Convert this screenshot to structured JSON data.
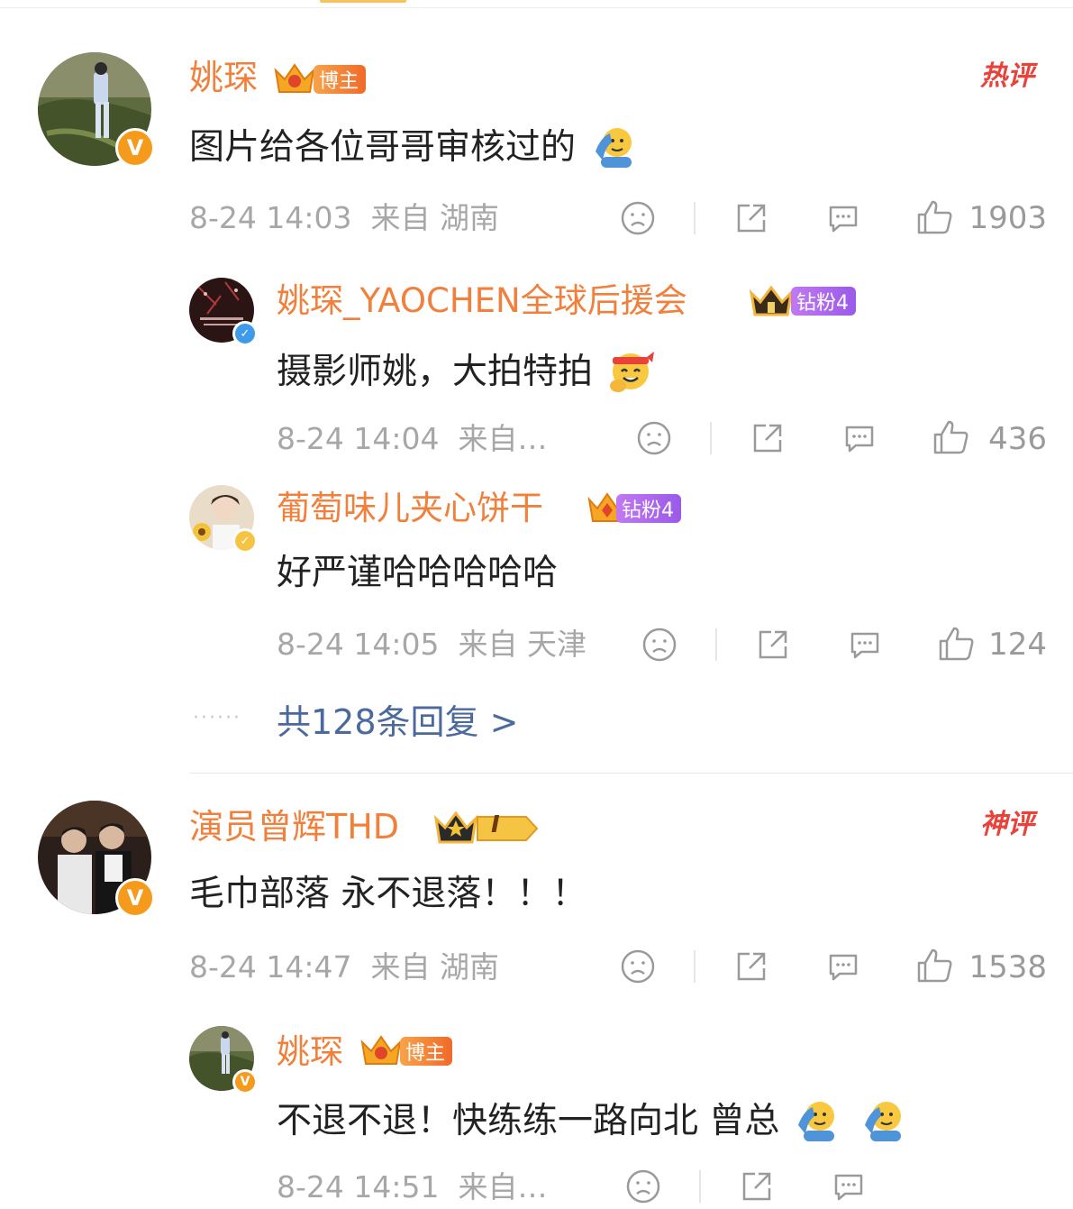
{
  "comments": [
    {
      "username": "姚琛",
      "badge": "博主",
      "text": "图片给各位哥哥审核过的",
      "emoji": "salute-emoji",
      "time": "8-24 14:03",
      "location": "来自 湖南",
      "likes": "1903",
      "tag": "热评",
      "replies": [
        {
          "username": "姚琛_YAOCHEN全球后援会",
          "badge": "钻粉4",
          "text": "摄影师姚，大拍特拍",
          "emoji": "headband-salute-emoji",
          "time": "8-24 14:04",
          "location": "来自…",
          "likes": "436"
        },
        {
          "username": "葡萄味儿夹心饼干",
          "badge": "钻粉4",
          "text": "好严谨哈哈哈哈哈",
          "time": "8-24 14:05",
          "location": "来自 天津",
          "likes": "124"
        }
      ],
      "more_replies": "共128条回复 >"
    },
    {
      "username": "演员曾辉THD",
      "badge": "I",
      "text": "毛巾部落 永不退落！！！",
      "time": "8-24 14:47",
      "location": "来自 湖南",
      "likes": "1538",
      "tag": "神评",
      "replies": [
        {
          "username": "姚琛",
          "badge": "博主",
          "text": "不退不退！快练练一路向北 曾总",
          "emoji": "salute-emoji",
          "time": "8-24 14:51",
          "location": "来自…",
          "likes": ""
        }
      ]
    }
  ],
  "colors": {
    "username": "#f0803c",
    "meta": "#a7a7a7",
    "hot": "#e8423a",
    "link": "#4a6a9c"
  },
  "icons": [
    "sad-face-icon",
    "share-icon",
    "comment-icon",
    "thumbs-up-icon",
    "v-verified-icon",
    "crown-icon"
  ]
}
